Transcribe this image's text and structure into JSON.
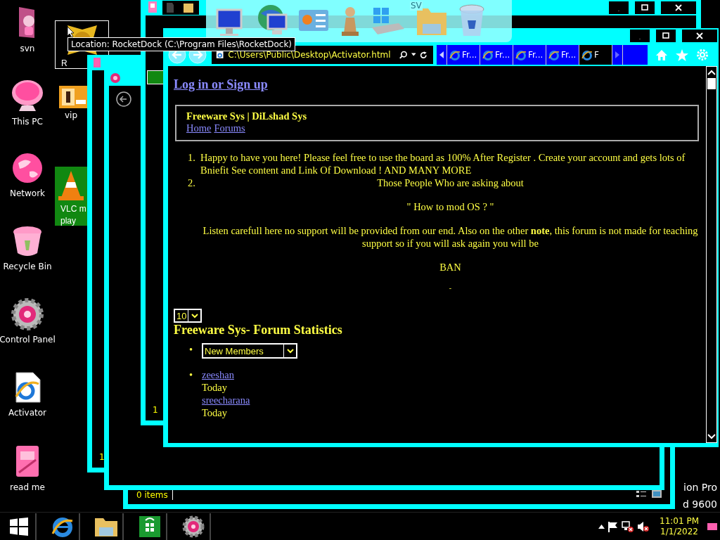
{
  "desktop_icons": [
    {
      "label": "svn",
      "kind": "door"
    },
    {
      "label": "This PC",
      "kind": "monitor"
    },
    {
      "label": "Network",
      "kind": "globe"
    },
    {
      "label": "Recycle Bin",
      "kind": "bin"
    },
    {
      "label": "Control Panel",
      "kind": "gear"
    },
    {
      "label": "Activator",
      "kind": "document"
    },
    {
      "label": "read me",
      "kind": "notebook"
    }
  ],
  "desktop_icons_column_2": [
    {
      "label": "R",
      "kind": "burst",
      "selected": true
    },
    {
      "label": "vip",
      "kind": "thumbnail",
      "selected": false
    },
    {
      "label": "VLC m",
      "label_2": "play",
      "kind": "cone",
      "selected": true
    }
  ],
  "tooltip": "Location: RocketDock (C:\\Program Files\\RocketDock)",
  "dock": {
    "label": "SV"
  },
  "background_windows": [
    {
      "footer": "1"
    },
    {
      "footer": "1"
    },
    {
      "status": "0 items"
    }
  ],
  "browser": {
    "address": "C:\\Users\\Public\\Desktop\\Activator.html",
    "tabs": [
      {
        "label": "Fr...",
        "selected": false
      },
      {
        "label": "Fr...",
        "selected": false
      },
      {
        "label": "Fr...",
        "selected": false
      },
      {
        "label": "Fr...",
        "selected": false
      },
      {
        "label": "F",
        "selected": true
      }
    ],
    "page": {
      "login_link": "Log in or Sign up",
      "site_title": "Freeware Sys | DiLshad Sys",
      "nav_links": [
        "Home",
        "Forums"
      ],
      "notice_markers": [
        "1.",
        "2."
      ],
      "stats_bullets": [
        "•",
        "•"
      ],
      "notice_1": "Happy to have you here! Please feel free to use the board as 100% After Register . Create your account and gets lots of Bniefit See content and Link Of Download ! AND MANY MORE",
      "notice_2": [
        "Those People Who are asking about",
        "\" How to mod OS ? \"",
        "Listen carefull here no support will be provided from our end. Also on the other **note**, this forum is not made for teaching support so if you will ask again you will be",
        "BAN",
        "-"
      ],
      "page_size_select": "10",
      "stats_heading": "Freeware Sys- Forum Statistics",
      "stats_select": "New Members",
      "members": [
        {
          "name": "zeeshan",
          "when": "Today"
        },
        {
          "name": "sreecharana",
          "when": "Today"
        }
      ]
    }
  },
  "desktop_text": [
    "ion Pro",
    "d 9600"
  ],
  "taskbar": {
    "time": "11:01 PM",
    "date": "1/1/2022"
  }
}
